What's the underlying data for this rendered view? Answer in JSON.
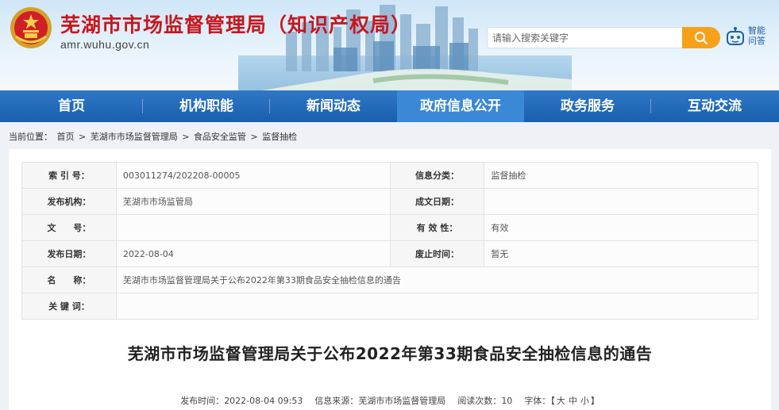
{
  "header": {
    "title": "芜湖市市场监督管理局（知识产权局）",
    "url": "amr.wuhu.gov.cn",
    "search_placeholder": "请输入搜索关键字",
    "robot_label_line1": "智能",
    "robot_label_line2": "问答",
    "colors": {
      "title_red": "#c8161d",
      "search_orange": "#f7a11a",
      "nav_blue": "#1a5fae"
    }
  },
  "nav": {
    "items": [
      {
        "label": "首页"
      },
      {
        "label": "机构职能"
      },
      {
        "label": "新闻动态"
      },
      {
        "label": "政府信息公开"
      },
      {
        "label": "政务服务"
      },
      {
        "label": "互动交流"
      }
    ],
    "active_index": 3
  },
  "breadcrumb": {
    "prefix": "当前位置：",
    "items": [
      "首页",
      "芜湖市市场监督管理局",
      "食品安全监管",
      "监督抽检"
    ],
    "separator": ">"
  },
  "meta": {
    "index_no_label": "索 引 号：",
    "index_no": "003011274/202208-00005",
    "category_label": "信息分类：",
    "category": "监督抽检",
    "publisher_label": "发布机构：",
    "publisher": "芜湖市市场监管局",
    "doc_date_label": "成文日期：",
    "doc_date": "",
    "doc_no_label": "文　　号：",
    "doc_no": "",
    "validity_label": "有 效 性：",
    "validity": "有效",
    "pub_date_label": "发布日期：",
    "pub_date": "2022-08-04",
    "expire_label": "废止时间：",
    "expire": "暂无",
    "name_label": "名　　称：",
    "name": "芜湖市市场监督管理局关于公布2022年第33期食品安全抽检信息的通告",
    "keywords_label": "关 键 词：",
    "keywords": ""
  },
  "article": {
    "title": "芜湖市市场监督管理局关于公布2022年第33期食品安全抽检信息的通告",
    "publish_time_label": "发布时间：",
    "publish_time": "2022-08-04 09:53",
    "source_label": "信息来源：",
    "source": "芜湖市市场监督管理局",
    "views_label": "阅读次数：",
    "views": "10",
    "fontsize_label": "字体：",
    "bracket_open": "【",
    "size_large": "大",
    "size_medium": "中",
    "size_small": "小",
    "bracket_close": "】"
  }
}
